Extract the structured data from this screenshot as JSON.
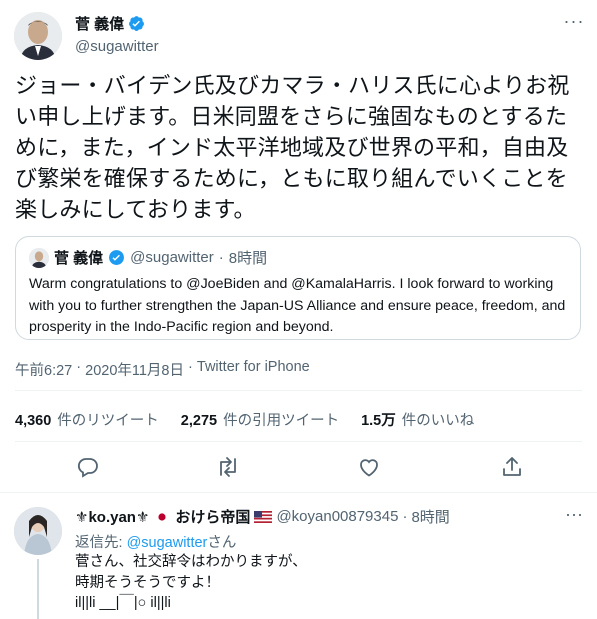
{
  "tweet": {
    "author_name": "菅 義偉",
    "author_handle": "@sugawitter",
    "more_label": "···",
    "text": "ジョー・バイデン氏及びカマラ・ハリス氏に心よりお祝い申し上げます。日米同盟をさらに強固なものとするために，また，インド太平洋地域及び世界の平和，自由及び繁栄を確保するために，ともに取り組んでいくことを楽しみにしております。",
    "quote": {
      "author_name": "菅 義偉",
      "author_handle": "@sugawitter",
      "time": "8時間",
      "text": "Warm congratulations to @JoeBiden and @KamalaHarris. I look forward to working with you to further strengthen the Japan-US Alliance and ensure peace, freedom, and prosperity in the Indo-Pacific region and beyond."
    },
    "time": "午前6:27",
    "date": "2020年11月8日",
    "source": "Twitter for iPhone",
    "stats": {
      "retweets_count": "4,360",
      "retweets_label": "件のリツイート",
      "quotes_count": "2,275",
      "quotes_label": "件の引用ツイート",
      "likes_count": "1.5万",
      "likes_label": "件のいいね"
    },
    "colors": {
      "verified": "#1d9bf0",
      "text_secondary": "#536471",
      "border": "#cfd9de"
    }
  },
  "reply": {
    "author_name_pre": "⚜ko.yan⚜",
    "author_name_mid": " おけら帝国",
    "author_handle": "@koyan00879345",
    "time": "8時間",
    "more_label": "···",
    "replying_prefix": "返信先: ",
    "replying_handle": "@sugawitter",
    "replying_suffix": "さん",
    "text_line1": "菅さん、社交辞令はわかりますが、",
    "text_line2": "時期そうそうですよ！",
    "text_line3": "il||li __|￣|○ il||li"
  },
  "icons": [
    "verified-badge-icon",
    "reply-icon",
    "retweet-icon",
    "like-icon",
    "share-icon",
    "japan-flag-icon",
    "us-flag-icon"
  ]
}
